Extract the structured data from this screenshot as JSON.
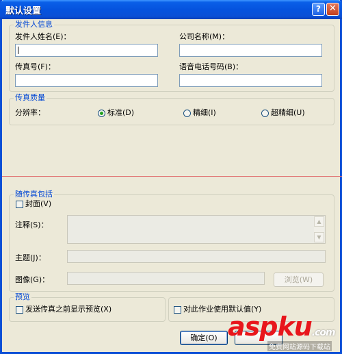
{
  "window": {
    "title": "默认设置",
    "help_glyph": "?",
    "close_glyph": "✕"
  },
  "sender": {
    "group_title": "发件人信息",
    "name_label": "发件人姓名(E)：",
    "company_label": "公司名称(M)：",
    "fax_label": "传真号(F)：",
    "voice_label": "语音电话号码(B)：",
    "name_value": "",
    "company_value": "",
    "fax_value": "",
    "voice_value": ""
  },
  "quality": {
    "group_title": "传真质量",
    "resolution_label": "分辨率：",
    "options": [
      "标准(D)",
      "精细(I)",
      "超精细(U)"
    ],
    "selected": "标准(D)"
  },
  "include": {
    "group_title": "随传真包括",
    "cover_label": "封面(V)",
    "note_label": "注释(S)：",
    "subject_label": "主题(J)：",
    "image_label": "图像(G)：",
    "browse_label": "浏览(W)"
  },
  "preview": {
    "group_title": "预览",
    "preview_check_label": "发送传真之前显示预览(X)",
    "default_check_label": "对此作业使用默认值(Y)"
  },
  "buttons": {
    "ok_label": "确定(O)"
  },
  "watermark": {
    "logo": "aspku",
    "logo_suffix": ".com",
    "sub": "免费网站源码下载站"
  },
  "colors": {
    "title_bar": "#0a4fd6",
    "group_title": "#0046d5",
    "radio_dot": "#21a121",
    "watermark": "#e8161c"
  }
}
